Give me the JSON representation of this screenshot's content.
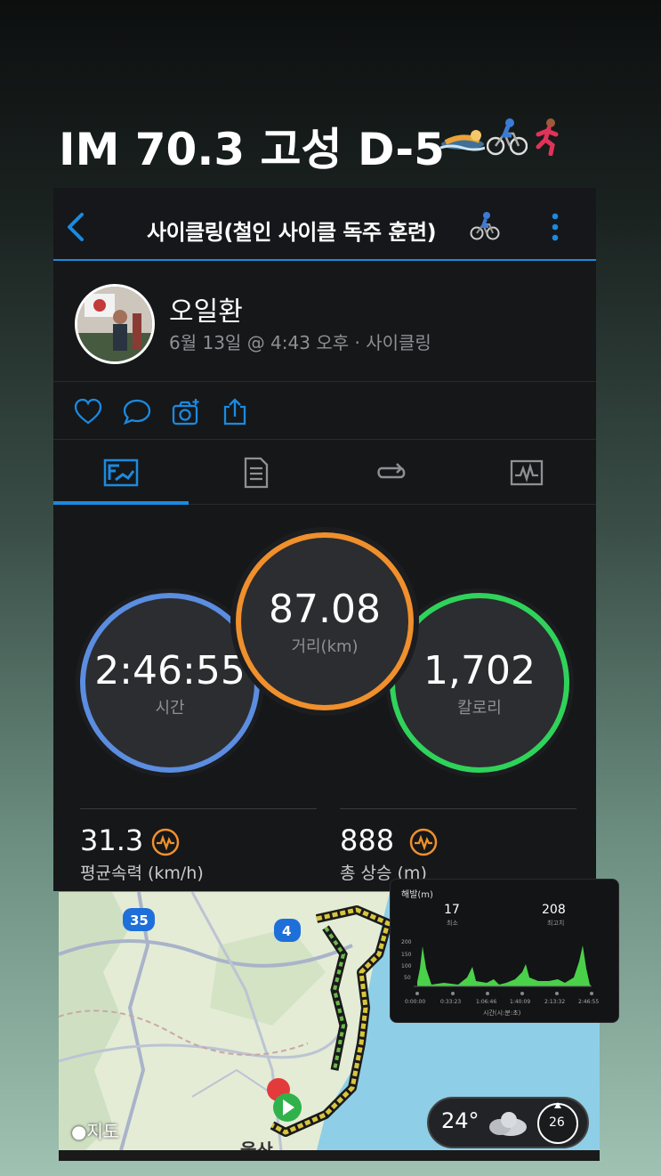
{
  "story": {
    "title": "IM 70.3 고성 D-5"
  },
  "app": {
    "header_title": "사이클링(철인 사이클 독주 훈련)",
    "accent": "#1b8ae0"
  },
  "profile": {
    "name": "오일환",
    "subtitle": "6월 13일 @ 4:43 오후 · 사이클링"
  },
  "actions": [
    "heart-icon",
    "comment-icon",
    "camera-icon",
    "share-icon"
  ],
  "tabs": [
    "overview-tab",
    "details-tab",
    "laps-tab",
    "stats-tab"
  ],
  "stats": {
    "time": {
      "value": "2:46:55",
      "label": "시간",
      "color": "#5b8de0"
    },
    "distance": {
      "value": "87.08",
      "label": "거리(km)",
      "color": "#f0902c"
    },
    "calories": {
      "value": "1,702",
      "label": "칼로리",
      "color": "#2fd35a"
    }
  },
  "metrics": {
    "avg_speed": {
      "value": "31.3",
      "label": "평균속력 (km/h)"
    },
    "elev_gain": {
      "value": "888",
      "label": "총 상승 (m)"
    }
  },
  "map": {
    "road_35": "35",
    "road_4": "4",
    "logo": "지도",
    "city": "울산"
  },
  "elevation": {
    "title": "해발(m)",
    "min_value": "17",
    "min_label": "최소",
    "max_value": "208",
    "max_label": "최고치",
    "y_ticks": [
      "200",
      "150",
      "100",
      "50"
    ],
    "x_ticks": [
      "0:00:00",
      "0:33:23",
      "1:06:46",
      "1:40:09",
      "2:13:32",
      "2:46:55"
    ],
    "x_label": "시간(시:분:초)"
  },
  "weather": {
    "temp": "24°",
    "wind": "26"
  }
}
